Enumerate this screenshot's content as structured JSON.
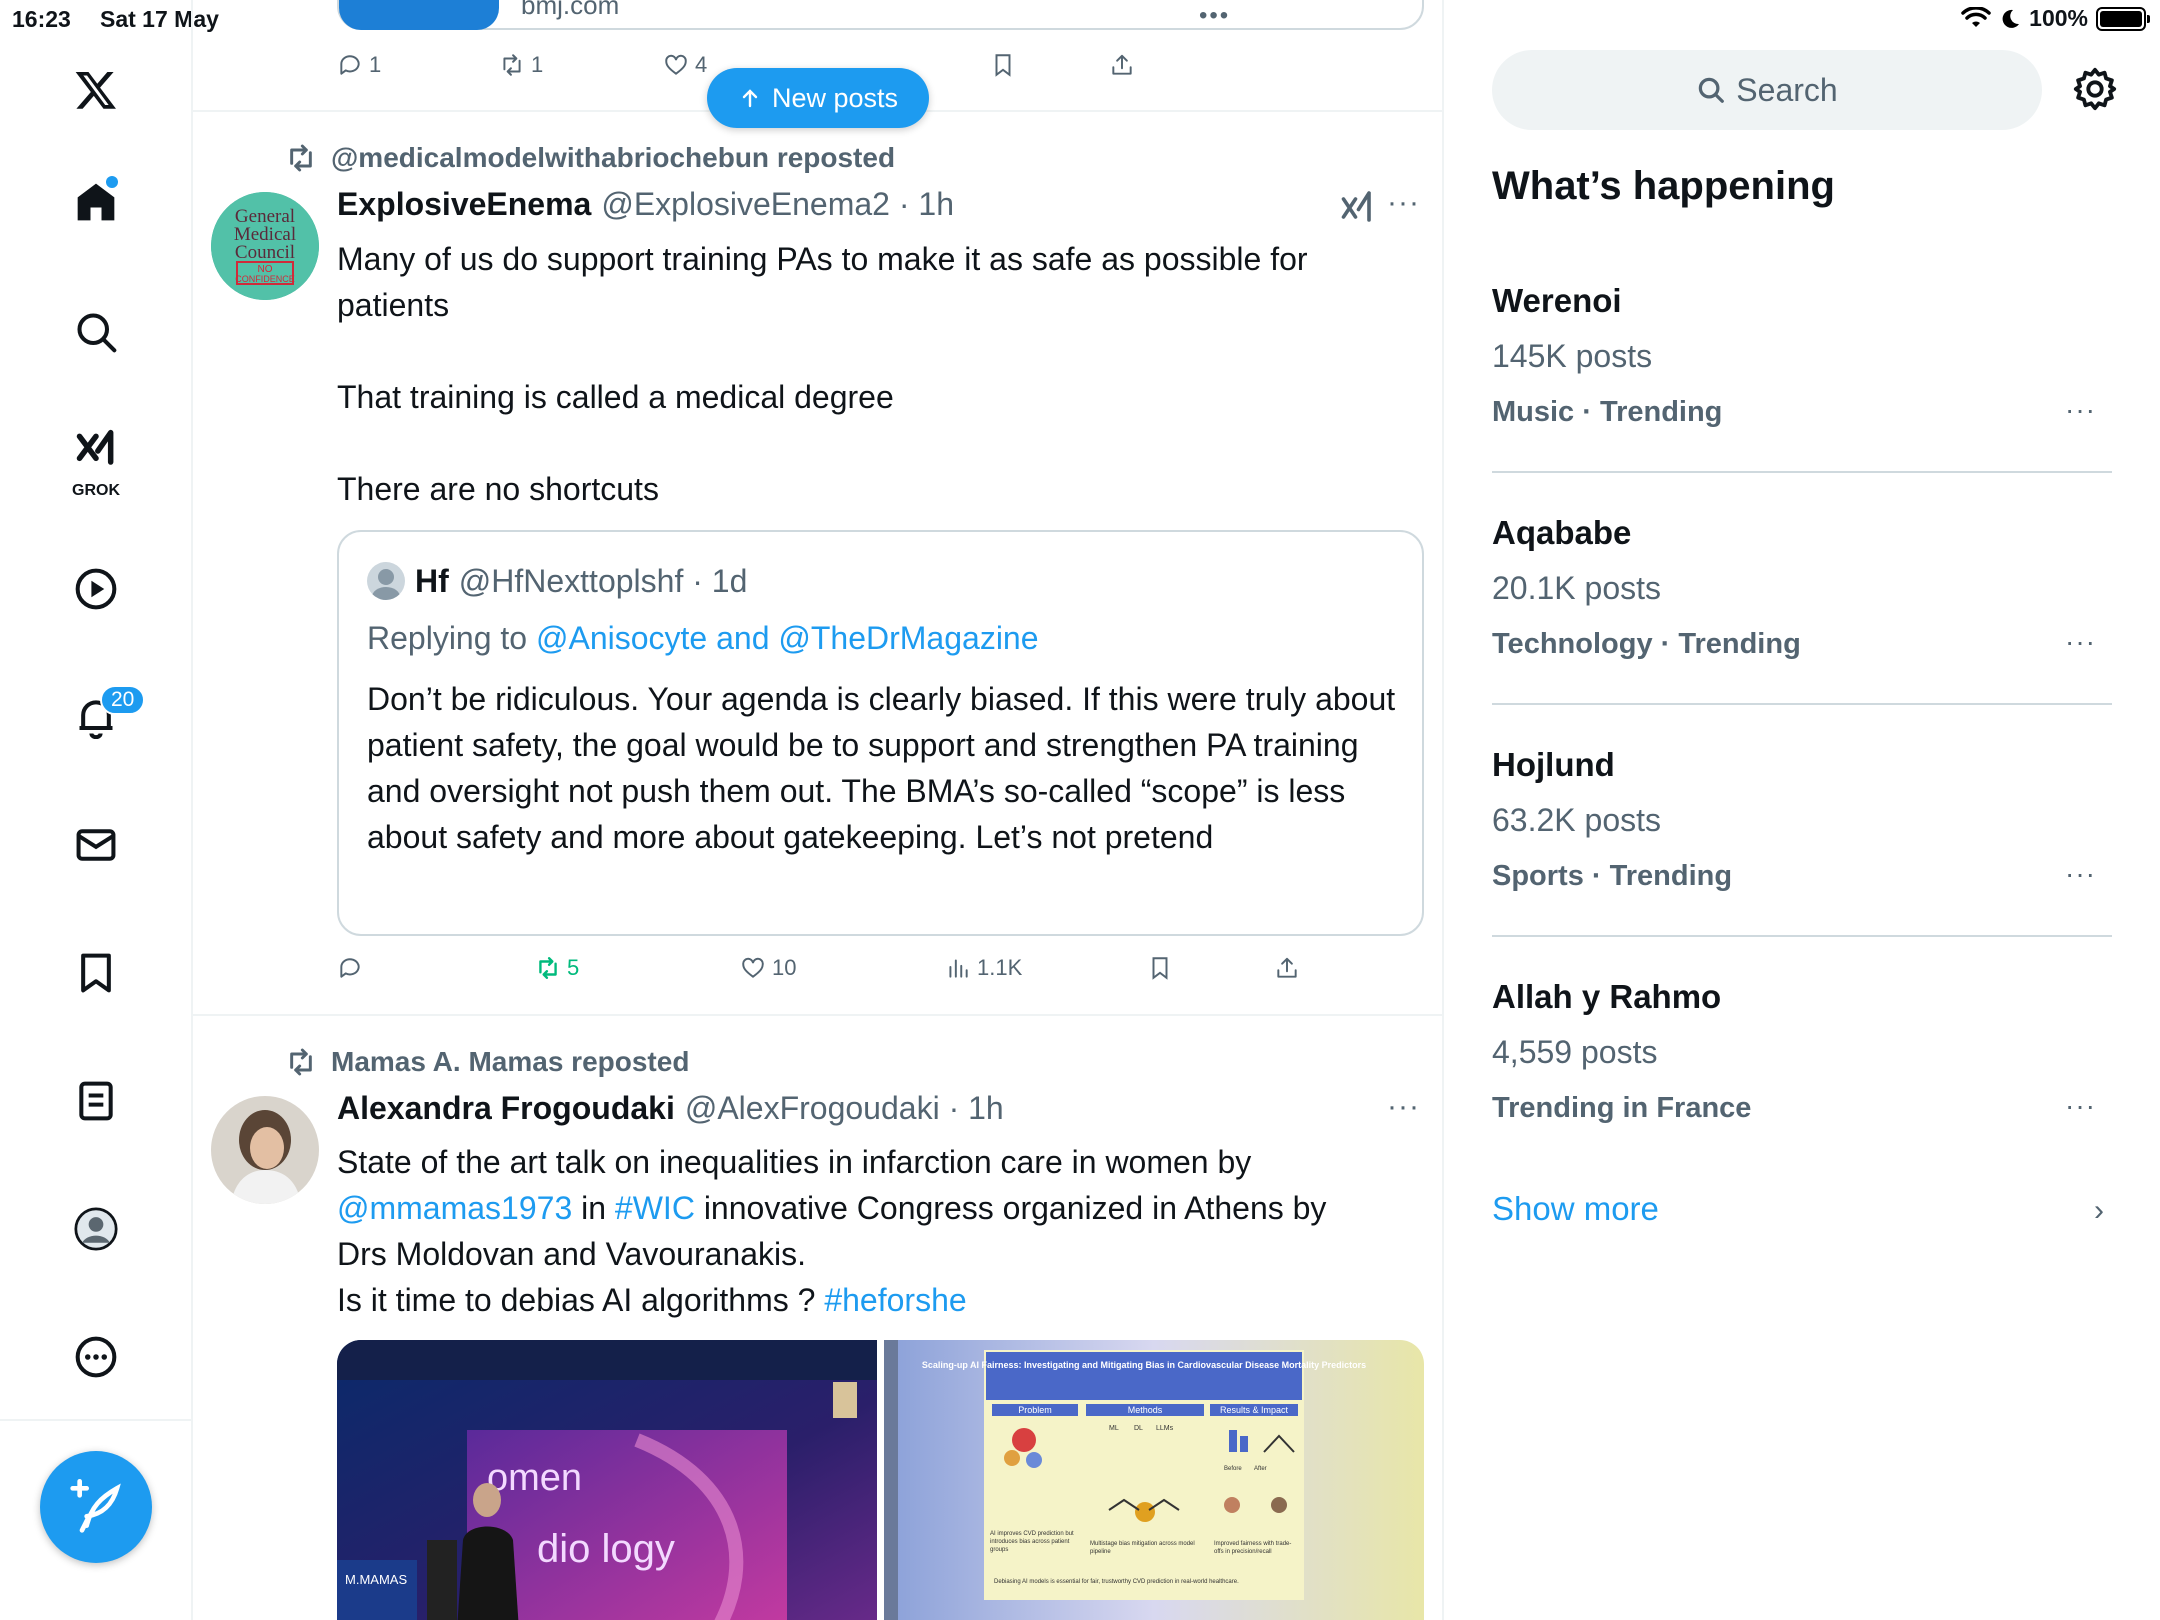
{
  "status_bar": {
    "time": "16:23",
    "date": "Sat 17 May",
    "battery": "100%"
  },
  "nav": {
    "grok_label": "GROK",
    "notifications_count": "20"
  },
  "prev_post": {
    "domain": "bmj.com",
    "dots": "•••",
    "replies": "1",
    "reposts": "1",
    "likes": "4"
  },
  "new_posts_label": "New posts",
  "posts": [
    {
      "repost_by": "@medicalmodelwithabriochebun reposted",
      "name": "ExplosiveEnema",
      "handle": "@ExplosiveEnema2 · 1h",
      "more": "···",
      "avatar_text": [
        "General",
        "Medical",
        "Council",
        "NO",
        "CONFIDENCE"
      ],
      "text_lines": [
        "Many of us do support training PAs to make it as safe as possible for patients",
        "That training is called a medical degree",
        "There are no shortcuts"
      ],
      "quote": {
        "name": "Hf",
        "handle": "@HfNexttoplshf · 1d",
        "replying_prefix": "Replying to ",
        "replying_to": "@Anisocyte and @TheDrMagazine",
        "text": "Don’t be ridiculous. Your agenda is clearly biased. If this were truly about patient safety, the goal would be to support and strengthen PA training and oversight not push them out. The BMA’s so-called “scope” is less about safety and more about gatekeeping. Let’s not pretend"
      },
      "actions": {
        "reposts": "5",
        "likes": "10",
        "views": "1.1K"
      }
    },
    {
      "repost_by": "Mamas A. Mamas reposted",
      "name": "Alexandra Frogoudaki",
      "handle": "@AlexFrogoudaki · 1h",
      "more": "···",
      "text_parts": {
        "line1": "State of the art talk on inequalities in infarction care in women by",
        "mention": "@mmamas1973",
        "in": " in ",
        "hashtag1": "#WIC",
        "line2_rest": " innovative Congress organized in Athens by",
        "line3": "Drs Moldovan and Vavouranakis.",
        "line4": "Is it time to debias AI algorithms ? ",
        "hashtag2": "#heforshe"
      },
      "media": {
        "left_text": "omen",
        "left_text2": "dio logy",
        "left_sign": "M.MAMAS",
        "slide_title": "Scaling-up AI Fairness: Investigating and Mitigating Bias in Cardiovascular Disease Mortality Predictors",
        "slide_col1": "Problem",
        "slide_col2": "Methods",
        "slide_col3": "Results & Impact",
        "slide_col1_text": "AI improves CVD prediction but introduces bias across patient groups",
        "slide_col2_text": "Multistage bias mitigation across model pipeline",
        "slide_col3_text": "Improved fairness with trade-offs in precision/recall",
        "slide_ml": "ML",
        "slide_dl": "DL",
        "slide_llm": "LLMs",
        "slide_before": "Before",
        "slide_after": "After",
        "slide_footer": "Debiasing AI models is essential for fair, trustworthy CVD prediction in real-world healthcare."
      }
    }
  ],
  "right": {
    "search_placeholder": "Search",
    "whats_happening": "What’s happening",
    "trends": [
      {
        "name": "Werenoi",
        "count": "145K posts",
        "category": "Music · Trending"
      },
      {
        "name": "Aqababe",
        "count": "20.1K posts",
        "category": "Technology · Trending"
      },
      {
        "name": "Hojlund",
        "count": "63.2K posts",
        "category": "Sports · Trending"
      },
      {
        "name": "Allah y Rahmo",
        "count": "4,559 posts",
        "category": "Trending in France"
      }
    ],
    "trend_more": "···",
    "show_more": "Show more",
    "chevron": "›"
  },
  "colors": {
    "accent": "#1d9bf0",
    "repost_green": "#00ba7c",
    "muted": "#536471"
  }
}
